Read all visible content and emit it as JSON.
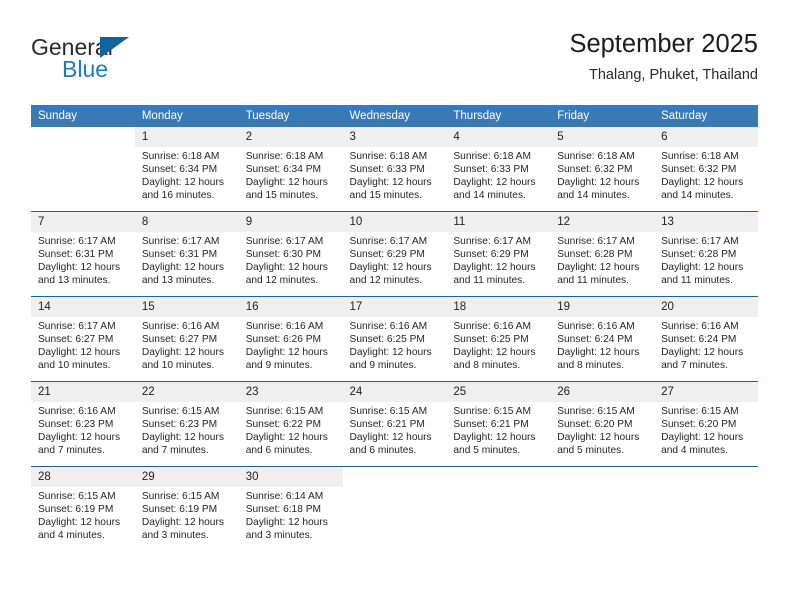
{
  "brand": {
    "name_part1": "General",
    "name_part2": "Blue",
    "triangle_icon": "brand-triangle-icon",
    "color_dark": "#2b2b2b",
    "color_blue": "#1b7ac4",
    "triangle_color": "#11659f"
  },
  "header": {
    "title": "September 2025",
    "subtitle": "Thalang, Phuket, Thailand"
  },
  "theme": {
    "header_row_bg": "#3a79b8",
    "header_row_text": "#ffffff",
    "daynum_bg": "#efefef",
    "week_separator": "#1f6099"
  },
  "weekdays": [
    "Sunday",
    "Monday",
    "Tuesday",
    "Wednesday",
    "Thursday",
    "Friday",
    "Saturday"
  ],
  "weeks": [
    [
      {
        "day": "",
        "sunrise": "",
        "sunset": "",
        "daylight": ""
      },
      {
        "day": "1",
        "sunrise": "Sunrise: 6:18 AM",
        "sunset": "Sunset: 6:34 PM",
        "daylight": "Daylight: 12 hours and 16 minutes."
      },
      {
        "day": "2",
        "sunrise": "Sunrise: 6:18 AM",
        "sunset": "Sunset: 6:34 PM",
        "daylight": "Daylight: 12 hours and 15 minutes."
      },
      {
        "day": "3",
        "sunrise": "Sunrise: 6:18 AM",
        "sunset": "Sunset: 6:33 PM",
        "daylight": "Daylight: 12 hours and 15 minutes."
      },
      {
        "day": "4",
        "sunrise": "Sunrise: 6:18 AM",
        "sunset": "Sunset: 6:33 PM",
        "daylight": "Daylight: 12 hours and 14 minutes."
      },
      {
        "day": "5",
        "sunrise": "Sunrise: 6:18 AM",
        "sunset": "Sunset: 6:32 PM",
        "daylight": "Daylight: 12 hours and 14 minutes."
      },
      {
        "day": "6",
        "sunrise": "Sunrise: 6:18 AM",
        "sunset": "Sunset: 6:32 PM",
        "daylight": "Daylight: 12 hours and 14 minutes."
      }
    ],
    [
      {
        "day": "7",
        "sunrise": "Sunrise: 6:17 AM",
        "sunset": "Sunset: 6:31 PM",
        "daylight": "Daylight: 12 hours and 13 minutes."
      },
      {
        "day": "8",
        "sunrise": "Sunrise: 6:17 AM",
        "sunset": "Sunset: 6:31 PM",
        "daylight": "Daylight: 12 hours and 13 minutes."
      },
      {
        "day": "9",
        "sunrise": "Sunrise: 6:17 AM",
        "sunset": "Sunset: 6:30 PM",
        "daylight": "Daylight: 12 hours and 12 minutes."
      },
      {
        "day": "10",
        "sunrise": "Sunrise: 6:17 AM",
        "sunset": "Sunset: 6:29 PM",
        "daylight": "Daylight: 12 hours and 12 minutes."
      },
      {
        "day": "11",
        "sunrise": "Sunrise: 6:17 AM",
        "sunset": "Sunset: 6:29 PM",
        "daylight": "Daylight: 12 hours and 11 minutes."
      },
      {
        "day": "12",
        "sunrise": "Sunrise: 6:17 AM",
        "sunset": "Sunset: 6:28 PM",
        "daylight": "Daylight: 12 hours and 11 minutes."
      },
      {
        "day": "13",
        "sunrise": "Sunrise: 6:17 AM",
        "sunset": "Sunset: 6:28 PM",
        "daylight": "Daylight: 12 hours and 11 minutes."
      }
    ],
    [
      {
        "day": "14",
        "sunrise": "Sunrise: 6:17 AM",
        "sunset": "Sunset: 6:27 PM",
        "daylight": "Daylight: 12 hours and 10 minutes."
      },
      {
        "day": "15",
        "sunrise": "Sunrise: 6:16 AM",
        "sunset": "Sunset: 6:27 PM",
        "daylight": "Daylight: 12 hours and 10 minutes."
      },
      {
        "day": "16",
        "sunrise": "Sunrise: 6:16 AM",
        "sunset": "Sunset: 6:26 PM",
        "daylight": "Daylight: 12 hours and 9 minutes."
      },
      {
        "day": "17",
        "sunrise": "Sunrise: 6:16 AM",
        "sunset": "Sunset: 6:25 PM",
        "daylight": "Daylight: 12 hours and 9 minutes."
      },
      {
        "day": "18",
        "sunrise": "Sunrise: 6:16 AM",
        "sunset": "Sunset: 6:25 PM",
        "daylight": "Daylight: 12 hours and 8 minutes."
      },
      {
        "day": "19",
        "sunrise": "Sunrise: 6:16 AM",
        "sunset": "Sunset: 6:24 PM",
        "daylight": "Daylight: 12 hours and 8 minutes."
      },
      {
        "day": "20",
        "sunrise": "Sunrise: 6:16 AM",
        "sunset": "Sunset: 6:24 PM",
        "daylight": "Daylight: 12 hours and 7 minutes."
      }
    ],
    [
      {
        "day": "21",
        "sunrise": "Sunrise: 6:16 AM",
        "sunset": "Sunset: 6:23 PM",
        "daylight": "Daylight: 12 hours and 7 minutes."
      },
      {
        "day": "22",
        "sunrise": "Sunrise: 6:15 AM",
        "sunset": "Sunset: 6:23 PM",
        "daylight": "Daylight: 12 hours and 7 minutes."
      },
      {
        "day": "23",
        "sunrise": "Sunrise: 6:15 AM",
        "sunset": "Sunset: 6:22 PM",
        "daylight": "Daylight: 12 hours and 6 minutes."
      },
      {
        "day": "24",
        "sunrise": "Sunrise: 6:15 AM",
        "sunset": "Sunset: 6:21 PM",
        "daylight": "Daylight: 12 hours and 6 minutes."
      },
      {
        "day": "25",
        "sunrise": "Sunrise: 6:15 AM",
        "sunset": "Sunset: 6:21 PM",
        "daylight": "Daylight: 12 hours and 5 minutes."
      },
      {
        "day": "26",
        "sunrise": "Sunrise: 6:15 AM",
        "sunset": "Sunset: 6:20 PM",
        "daylight": "Daylight: 12 hours and 5 minutes."
      },
      {
        "day": "27",
        "sunrise": "Sunrise: 6:15 AM",
        "sunset": "Sunset: 6:20 PM",
        "daylight": "Daylight: 12 hours and 4 minutes."
      }
    ],
    [
      {
        "day": "28",
        "sunrise": "Sunrise: 6:15 AM",
        "sunset": "Sunset: 6:19 PM",
        "daylight": "Daylight: 12 hours and 4 minutes."
      },
      {
        "day": "29",
        "sunrise": "Sunrise: 6:15 AM",
        "sunset": "Sunset: 6:19 PM",
        "daylight": "Daylight: 12 hours and 3 minutes."
      },
      {
        "day": "30",
        "sunrise": "Sunrise: 6:14 AM",
        "sunset": "Sunset: 6:18 PM",
        "daylight": "Daylight: 12 hours and 3 minutes."
      },
      {
        "day": "",
        "sunrise": "",
        "sunset": "",
        "daylight": ""
      },
      {
        "day": "",
        "sunrise": "",
        "sunset": "",
        "daylight": ""
      },
      {
        "day": "",
        "sunrise": "",
        "sunset": "",
        "daylight": ""
      },
      {
        "day": "",
        "sunrise": "",
        "sunset": "",
        "daylight": ""
      }
    ]
  ]
}
